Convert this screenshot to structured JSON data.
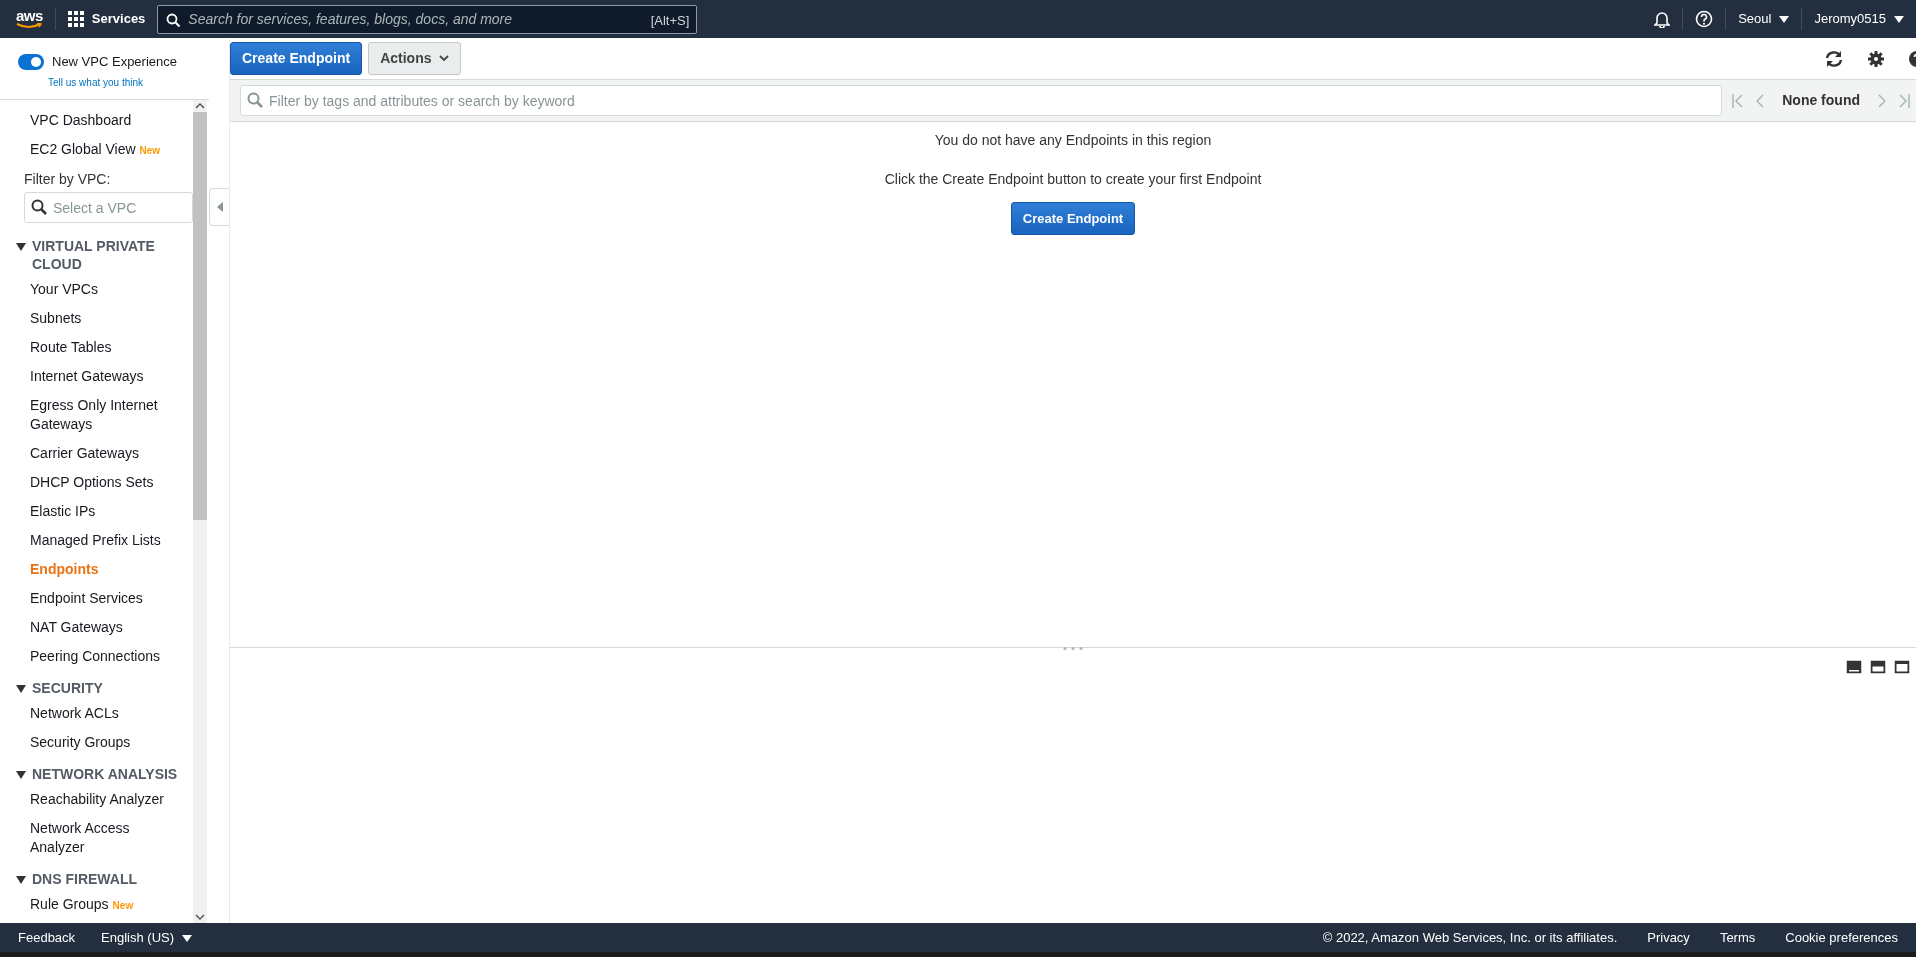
{
  "top_nav": {
    "logo": "aws",
    "services": "Services",
    "search_placeholder": "Search for services, features, blogs, docs, and more",
    "shortcut": "[Alt+S]",
    "region": "Seoul",
    "user": "Jeromy0515"
  },
  "sidebar": {
    "toggle": {
      "label": "New VPC Experience",
      "on": true
    },
    "feedback_link": "Tell us what you think",
    "top_items": [
      {
        "label": "VPC Dashboard",
        "selected": false
      },
      {
        "label": "EC2 Global View",
        "badge": "New",
        "selected": false
      }
    ],
    "filter": {
      "label": "Filter by VPC:",
      "placeholder": "Select a VPC"
    },
    "sections": [
      {
        "title": "VIRTUAL PRIVATE CLOUD",
        "expanded": true,
        "items": [
          {
            "label": "Your VPCs",
            "selected": false
          },
          {
            "label": "Subnets",
            "selected": false
          },
          {
            "label": "Route Tables",
            "selected": false
          },
          {
            "label": "Internet Gateways",
            "selected": false
          },
          {
            "label": "Egress Only Internet Gateways",
            "selected": false
          },
          {
            "label": "Carrier Gateways",
            "selected": false
          },
          {
            "label": "DHCP Options Sets",
            "selected": false
          },
          {
            "label": "Elastic IPs",
            "selected": false
          },
          {
            "label": "Managed Prefix Lists",
            "selected": false
          },
          {
            "label": "Endpoints",
            "selected": true
          },
          {
            "label": "Endpoint Services",
            "selected": false
          },
          {
            "label": "NAT Gateways",
            "selected": false
          },
          {
            "label": "Peering Connections",
            "selected": false
          }
        ]
      },
      {
        "title": "SECURITY",
        "expanded": true,
        "items": [
          {
            "label": "Network ACLs",
            "selected": false
          },
          {
            "label": "Security Groups",
            "selected": false
          }
        ]
      },
      {
        "title": "NETWORK ANALYSIS",
        "expanded": true,
        "items": [
          {
            "label": "Reachability Analyzer",
            "selected": false
          },
          {
            "label": "Network Access Analyzer",
            "selected": false
          }
        ]
      },
      {
        "title": "DNS FIREWALL",
        "expanded": true,
        "items": [
          {
            "label": "Rule Groups",
            "badge": "New",
            "selected": false
          }
        ]
      }
    ]
  },
  "toolbar": {
    "create_button": "Create Endpoint",
    "actions_button": "Actions"
  },
  "filter": {
    "placeholder": "Filter by tags and attributes or search by keyword",
    "pager": "None found"
  },
  "empty_state": {
    "message": "You do not have any Endpoints in this region",
    "hint": "Click the Create Endpoint button to create your first Endpoint",
    "button": "Create Endpoint"
  },
  "footer": {
    "feedback": "Feedback",
    "language": "English (US)",
    "copyright": "© 2022, Amazon Web Services, Inc. or its affiliates.",
    "links": [
      "Privacy",
      "Terms",
      "Cookie preferences"
    ]
  }
}
